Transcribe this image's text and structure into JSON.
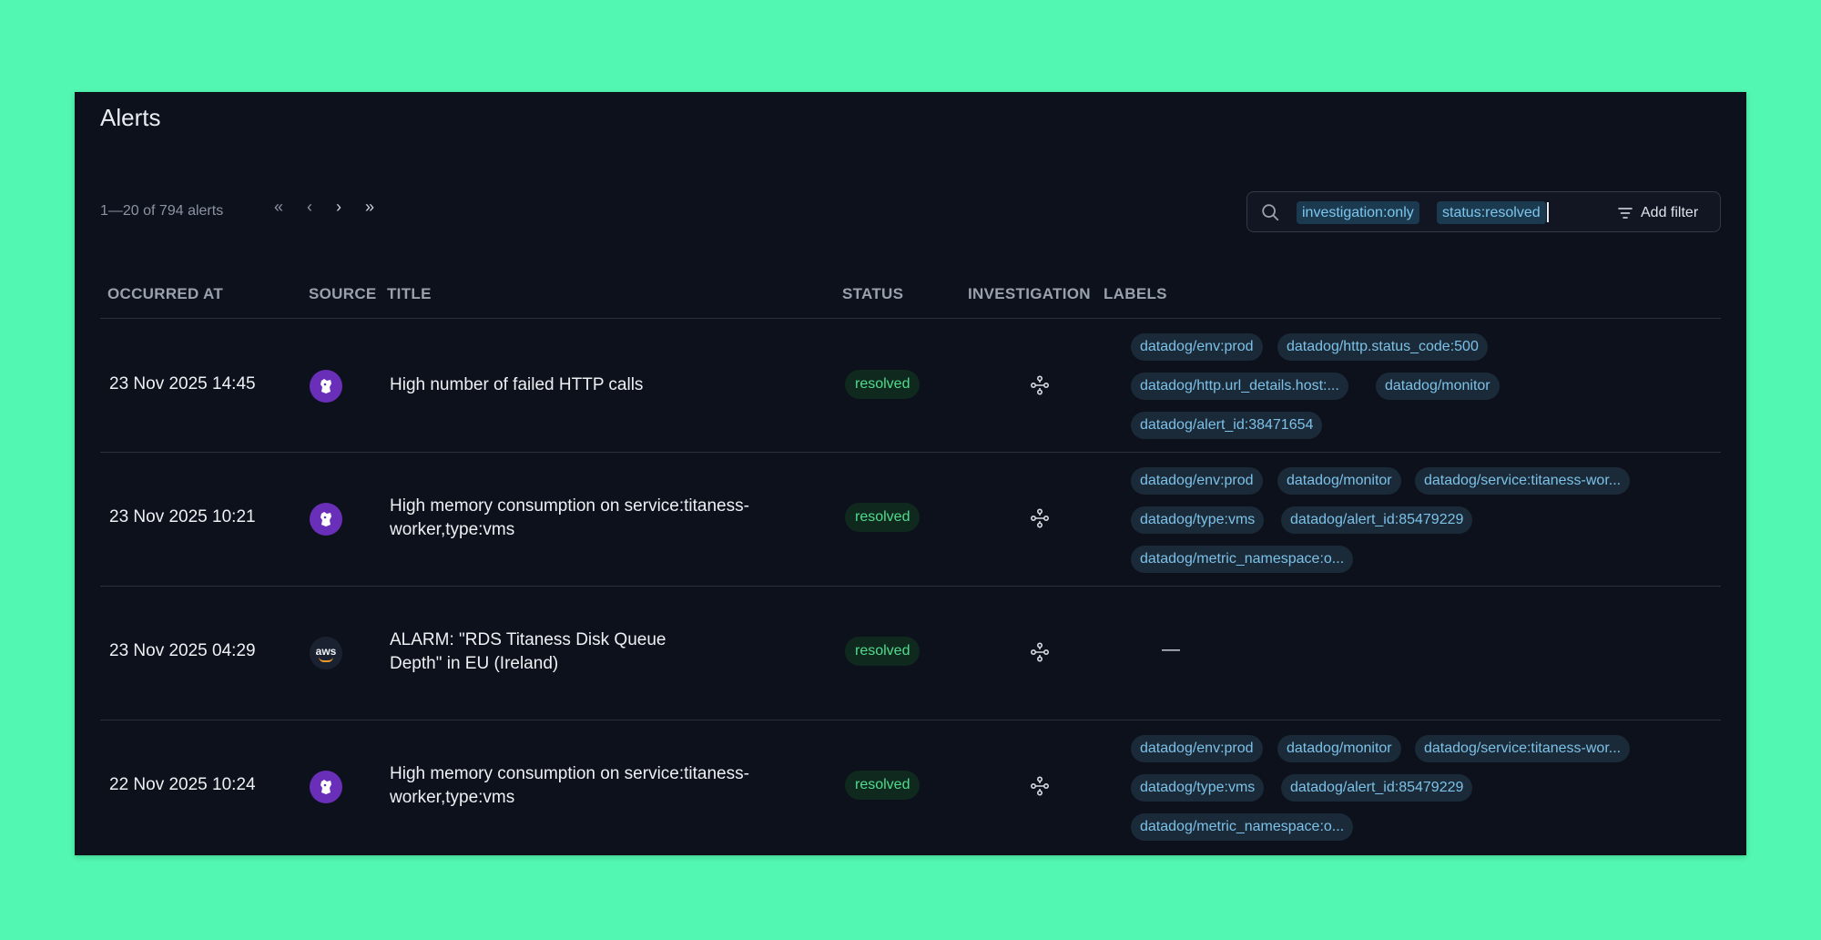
{
  "page": {
    "title": "Alerts"
  },
  "pagination": {
    "summary": "1—20 of 794 alerts",
    "first": "«",
    "prev": "‹",
    "next": "›",
    "last": "»"
  },
  "search": {
    "icon": "search-icon",
    "filters": [
      "investigation:only",
      "status:resolved"
    ],
    "add_filter_label": "Add filter",
    "add_filter_icon": "filter-icon"
  },
  "table": {
    "columns": [
      "OCCURRED AT",
      "SOURCE",
      "TITLE",
      "STATUS",
      "INVESTIGATION",
      "LABELS"
    ],
    "rows": [
      {
        "occurred_at": "23 Nov 2025 14:45",
        "source": "datadog",
        "title": "High number of failed HTTP calls",
        "status": "resolved",
        "labels": [
          "datadog/env:prod",
          "datadog/http.status_code:500",
          "datadog/http.url_details.host:...",
          "datadog/monitor",
          "datadog/alert_id:38471654"
        ]
      },
      {
        "occurred_at": "23 Nov 2025 10:21",
        "source": "datadog",
        "title": "High memory consumption on service:titaness-worker,type:vms",
        "status": "resolved",
        "labels": [
          "datadog/env:prod",
          "datadog/monitor",
          "datadog/service:titaness-wor...",
          "datadog/type:vms",
          "datadog/alert_id:85479229",
          "datadog/metric_namespace:o..."
        ]
      },
      {
        "occurred_at": "23 Nov 2025 04:29",
        "source": "aws",
        "source_text": "aws",
        "title": "ALARM: \"RDS Titaness Disk Queue Depth\" in EU (Ireland)",
        "status": "resolved",
        "labels": [],
        "empty_labels": "—"
      },
      {
        "occurred_at": "22 Nov 2025 10:24",
        "source": "datadog",
        "title": "High memory consumption on service:titaness-worker,type:vms",
        "status": "resolved",
        "labels": [
          "datadog/env:prod",
          "datadog/monitor",
          "datadog/service:titaness-wor...",
          "datadog/type:vms",
          "datadog/alert_id:85479229",
          "datadog/metric_namespace:o..."
        ]
      }
    ]
  },
  "colors": {
    "background": "#52f7b1",
    "panel": "#0d111b",
    "status_resolved": "#4fdc8d",
    "label_text": "#7cc1e8",
    "datadog_brand": "#6a2fb8",
    "aws_accent": "#f29b2a"
  }
}
